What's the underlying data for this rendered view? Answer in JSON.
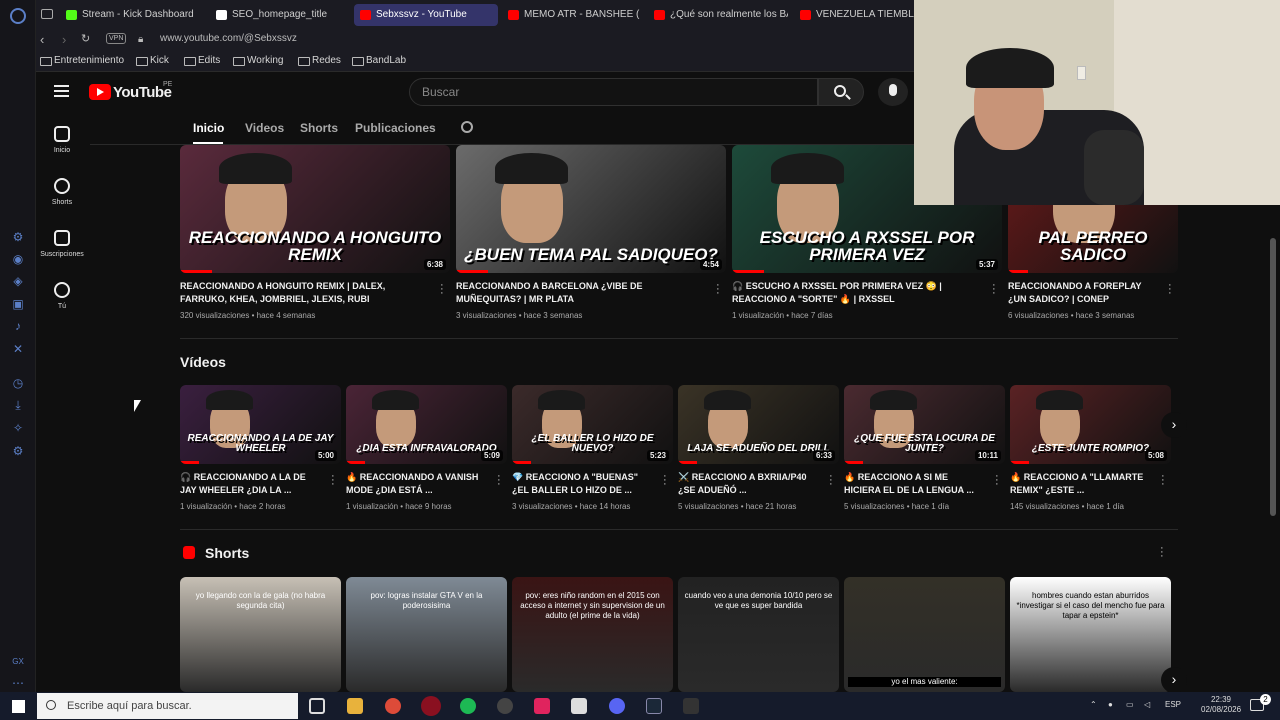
{
  "browser": {
    "tabs": [
      {
        "label": "Stream - Kick Dashboard",
        "color": "#53fc18"
      },
      {
        "label": "SEO_homepage_title",
        "color": "#ffffff"
      },
      {
        "label": "Sebxssvz - YouTube",
        "color": "#ff0000",
        "active": true
      },
      {
        "label": "MEMO ATR - BANSHEE ( V",
        "color": "#ff0000"
      },
      {
        "label": "¿Qué son realmente los BA",
        "color": "#ff0000"
      },
      {
        "label": "VENEZUELA TIEMBLA:",
        "color": "#ff0000"
      }
    ],
    "vpn_label": "VPN",
    "url": "www.youtube.com/@Sebxssvz",
    "bookmarks": [
      "Entretenimiento",
      "Kick",
      "Edits",
      "Working",
      "Redes",
      "BandLab"
    ]
  },
  "youtube": {
    "logo_text": "YouTube",
    "country": "PE",
    "search_placeholder": "Buscar",
    "nav": [
      {
        "label": "Inicio",
        "icon": "home-icon"
      },
      {
        "label": "Shorts",
        "icon": "shorts-icon"
      },
      {
        "label": "Suscripciones",
        "icon": "subscriptions-icon"
      },
      {
        "label": "Tú",
        "icon": "you-icon"
      }
    ],
    "channel_tabs": [
      "Inicio",
      "Videos",
      "Shorts",
      "Publicaciones"
    ]
  },
  "featured": [
    {
      "thumb_text": "REACCIONANDO A HONGUITO REMIX",
      "duration": "6:38",
      "title": "REACCIONANDO A HONGUITO REMIX | DALEX, FARRUKO, KHEA, JOMBRIEL, JLEXIS, RUBI",
      "meta": "320 visualizaciones • hace 4 semanas",
      "bg": "#5a2a3c"
    },
    {
      "thumb_text": "¿BUEN TEMA PAL SADIQUEO?",
      "duration": "4:54",
      "title": "REACCIONANDO A BARCELONA ¿VIBE DE MUÑEQUITAS? | MR PLATA",
      "meta": "3 visualizaciones • hace 3 semanas",
      "bg": "#6b6b6b"
    },
    {
      "thumb_text": "ESCUCHO A RXSSEL POR PRIMERA VEZ",
      "duration": "5:37",
      "title": "🎧 ESCUCHO A RXSSEL POR PRIMERA VEZ 😳 | REACCIONO A \"SORTE\" 🔥 | RXSSEL",
      "meta": "1 visualización • hace 7 días",
      "bg": "#1d4a3a"
    },
    {
      "thumb_text": "PAL PERREO SADICO",
      "duration": "",
      "title": "REACCIONANDO A FOREPLAY ¿UN SADICO? | CONEP",
      "meta": "6 visualizaciones • hace 3 semanas",
      "bg": "#6a1a1a"
    }
  ],
  "videos_section": {
    "title": "Vídeos",
    "items": [
      {
        "thumb_text": "REACCIONANDO A LA DE JAY WHEELER",
        "duration": "5:00",
        "title": "🎧 REACCIONANDO A LA DE JAY WHEELER ¿DIA LA ...",
        "meta": "1 visualización • hace 2 horas",
        "bg": "#3a1f3f"
      },
      {
        "thumb_text": "¿DIA ESTA INFRAVALORADO",
        "duration": "5:09",
        "title": "🔥 REACCIONANDO A VANISH MODE ¿DIA ESTÁ ...",
        "meta": "1 visualización • hace 9 horas",
        "bg": "#4a2436"
      },
      {
        "thumb_text": "¿EL BALLER LO HIZO DE NUEVO?",
        "duration": "5:23",
        "title": "💎 REACCIONO A \"BUENAS\" ¿EL BALLER LO HIZO DE ...",
        "meta": "3 visualizaciones • hace 14 horas",
        "bg": "#3b2a2a"
      },
      {
        "thumb_text": "LAJA SE ADUEÑO DEL DRILL",
        "duration": "6:33",
        "title": "⚔️ REACCIONO A BXRIIA/P40 ¿SE ADUEÑÓ ...",
        "meta": "5 visualizaciones • hace 21 horas",
        "bg": "#3a3326"
      },
      {
        "thumb_text": "¿QUE FUE ESTA LOCURA DE JUNTE?",
        "duration": "10:11",
        "title": "🔥 REACCIONO A SI ME HICIERA EL DE LA LENGUA ...",
        "meta": "5 visualizaciones • hace 1 día",
        "bg": "#4a2a30"
      },
      {
        "thumb_text": "¿ESTE JUNTE ROMPIO?",
        "duration": "5:08",
        "title": "🔥 REACCIONO A \"LLAMARTE REMIX\" ¿ESTE ...",
        "meta": "145 visualizaciones • hace 1 día",
        "bg": "#5a2224"
      }
    ]
  },
  "shorts_section": {
    "title": "Shorts",
    "items": [
      {
        "text": "yo llegando con la de gala (no habra segunda cita)",
        "bg": "#c7c0b5"
      },
      {
        "text": "pov: logras instalar GTA V en la poderosisima",
        "bg": "#7f8a95"
      },
      {
        "text": "pov: eres niño random en el 2015 con acceso a internet y sin supervision de un adulto (el prime de la vida)",
        "bg": "#3a1414"
      },
      {
        "text": "cuando veo a una demonia 10/10 pero se ve que es super bandida",
        "bg": "#222222"
      },
      {
        "text": "yo el mas valiente:",
        "bg": "#333027"
      },
      {
        "text": "hombres cuando estan aburridos *investigar si el caso del mencho fue para tapar a epstein*",
        "bg": "#ffffff"
      }
    ]
  },
  "taskbar": {
    "search_placeholder": "Escribe aquí para buscar.",
    "lang": "ESP",
    "time": "22:39",
    "date": "02/08/2026",
    "notifications": "2"
  }
}
